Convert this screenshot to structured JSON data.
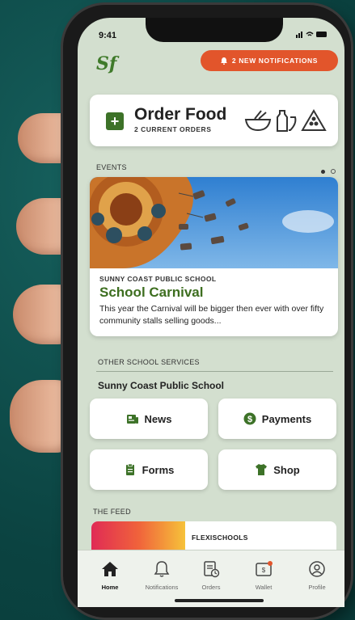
{
  "status": {
    "time": "9:41",
    "icons": "▮▮ ◠ ▬"
  },
  "header": {
    "logo": "Sf",
    "notifications_label": "2 NEW NOTIFICATIONS"
  },
  "order": {
    "title": "Order Food",
    "subtitle": "2 CURRENT ORDERS",
    "plus": "+"
  },
  "events": {
    "section_label": "EVENTS",
    "card": {
      "school": "SUNNY COAST PUBLIC SCHOOL",
      "title": "School Carnival",
      "description": "This year the Carnival will be bigger then ever with over fifty community stalls selling goods..."
    }
  },
  "services": {
    "section_label": "OTHER SCHOOL SERVICES",
    "school_name": "Sunny Coast Public School",
    "buttons": [
      {
        "label": "News",
        "icon": "news-icon"
      },
      {
        "label": "Payments",
        "icon": "payments-icon"
      },
      {
        "label": "Forms",
        "icon": "forms-icon"
      },
      {
        "label": "Shop",
        "icon": "shirt-icon"
      }
    ]
  },
  "feed": {
    "section_label": "THE FEED",
    "brand": "FLEXISCHOOLS"
  },
  "tabbar": {
    "tabs": [
      {
        "label": "Home",
        "icon": "home-icon",
        "active": true
      },
      {
        "label": "Notifications",
        "icon": "bell-icon",
        "active": false
      },
      {
        "label": "Orders",
        "icon": "orders-icon",
        "active": false
      },
      {
        "label": "Wallet",
        "icon": "wallet-icon",
        "active": false
      },
      {
        "label": "Profile",
        "icon": "profile-icon",
        "active": false
      }
    ]
  },
  "colors": {
    "accent_green": "#3d7228",
    "notification_orange": "#e2552b",
    "screen_bg": "#d3dfcf"
  }
}
